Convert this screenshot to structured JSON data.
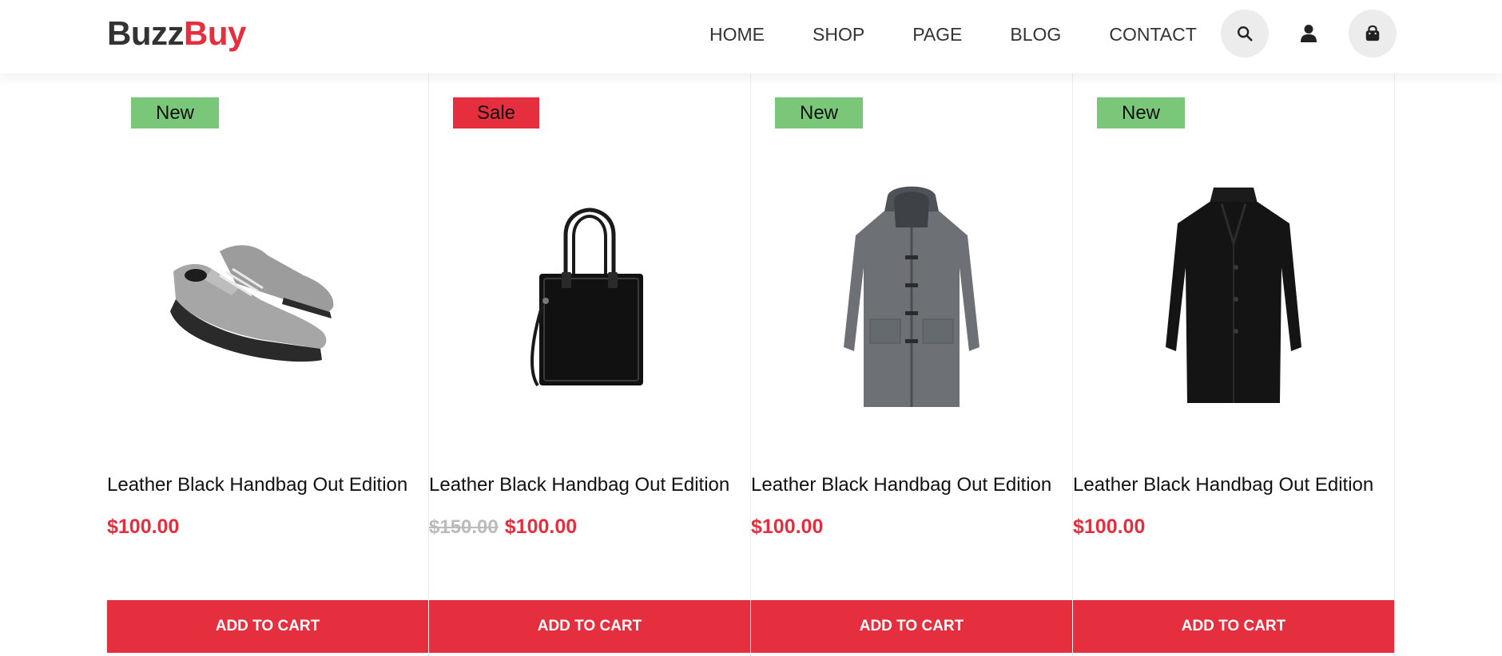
{
  "brand": {
    "part1": "Buzz",
    "part2": "Buy"
  },
  "nav": [
    "HOME",
    "SHOP",
    "PAGE",
    "BLOG",
    "CONTACT"
  ],
  "header_icons": [
    "search-icon",
    "user-icon",
    "shopping-bag-icon"
  ],
  "colors": {
    "accent": "#e52e3e",
    "badge_new": "#7bc77a",
    "badge_sale": "#e52e3e"
  },
  "products": [
    {
      "badge": "New",
      "badge_type": "new",
      "image": "grey-sneakers",
      "title": "Leather Black Handbag Out Edition",
      "old_price": "",
      "price": "$100.00",
      "button": "ADD TO CART"
    },
    {
      "badge": "Sale",
      "badge_type": "sale",
      "image": "black-tote-handbag",
      "title": "Leather Black Handbag Out Edition",
      "old_price": "$150.00",
      "price": "$100.00",
      "button": "ADD TO CART"
    },
    {
      "badge": "New",
      "badge_type": "new",
      "image": "grey-duffle-coat",
      "title": "Leather Black Handbag Out Edition",
      "old_price": "",
      "price": "$100.00",
      "button": "ADD TO CART"
    },
    {
      "badge": "New",
      "badge_type": "new",
      "image": "black-overcoat",
      "title": "Leather Black Handbag Out Edition",
      "old_price": "",
      "price": "$100.00",
      "button": "ADD TO CART"
    }
  ]
}
